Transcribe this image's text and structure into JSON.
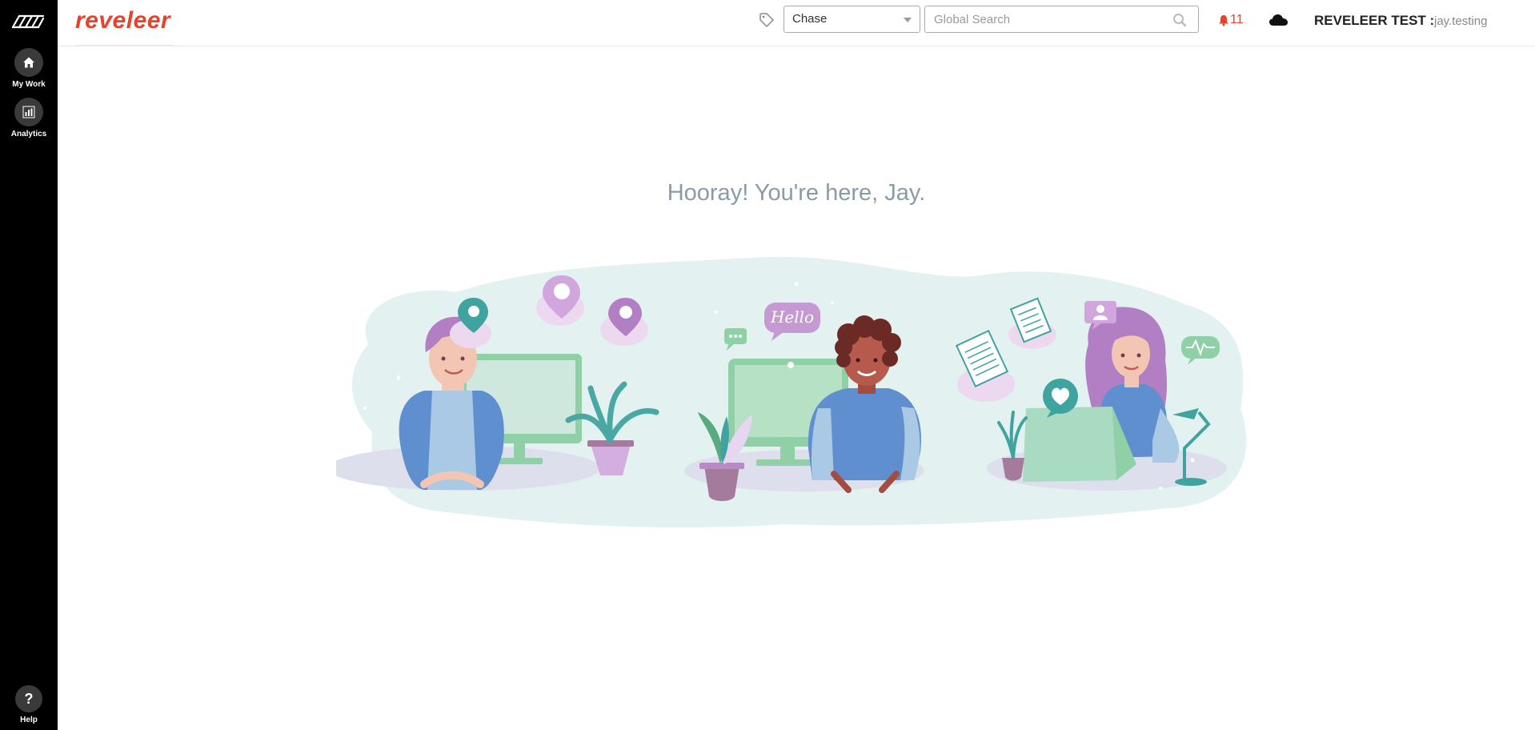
{
  "nav": {
    "items": [
      {
        "label": "My Work",
        "icon": "home-icon"
      },
      {
        "label": "Analytics",
        "icon": "analytics-icon"
      }
    ],
    "help": {
      "label": "Help",
      "glyph": "?"
    }
  },
  "header": {
    "brand": "reveleer",
    "client_select": {
      "value": "Chase"
    },
    "search": {
      "placeholder": "Global Search"
    },
    "notifications": {
      "count": "11"
    },
    "org_label": "REVELEER TEST :",
    "username": "jay.testing"
  },
  "main": {
    "welcome": "Hooray! You're here, Jay.",
    "speech_bubble": "Hello"
  },
  "colors": {
    "brand": "#e8412c",
    "nav_bg": "#000000",
    "welcome_text": "#8a9ba8"
  }
}
